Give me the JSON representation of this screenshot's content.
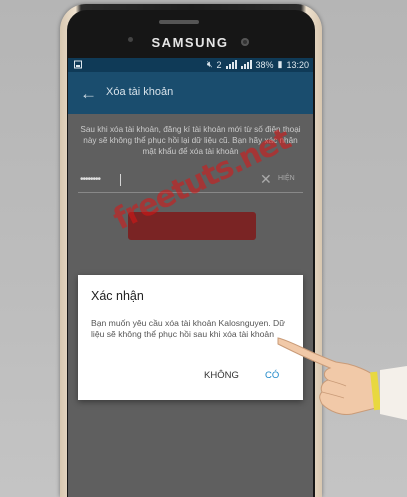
{
  "device": {
    "brand": "SAMSUNG"
  },
  "status_bar": {
    "battery": "38%",
    "time": "13:20",
    "network": "2"
  },
  "app_bar": {
    "title": "Xóa tài khoản"
  },
  "content": {
    "description": "Sau khi xóa tài khoản, đăng kí tài khoản mới từ số điện thoại này sẽ không thể phục hồi lại dữ liệu cũ. Bạn hãy xác nhận mật khẩu để xóa tài khoản",
    "password_value": "••••••••",
    "show_label": "HIỆN"
  },
  "dialog": {
    "title": "Xác nhận",
    "message": "Bạn muốn yêu cầu xóa tài khoản Kalosnguyen. Dữ liệu sẽ không thể phục hồi sau khi xóa tài khoản",
    "cancel_label": "KHÔNG",
    "confirm_label": "CÓ"
  },
  "watermark": {
    "text": "freetuts.net"
  },
  "colors": {
    "appbar": "#1a4d6e",
    "status_bar": "#0f3a57",
    "accent": "#1e88c9",
    "watermark": "#dc1414"
  }
}
